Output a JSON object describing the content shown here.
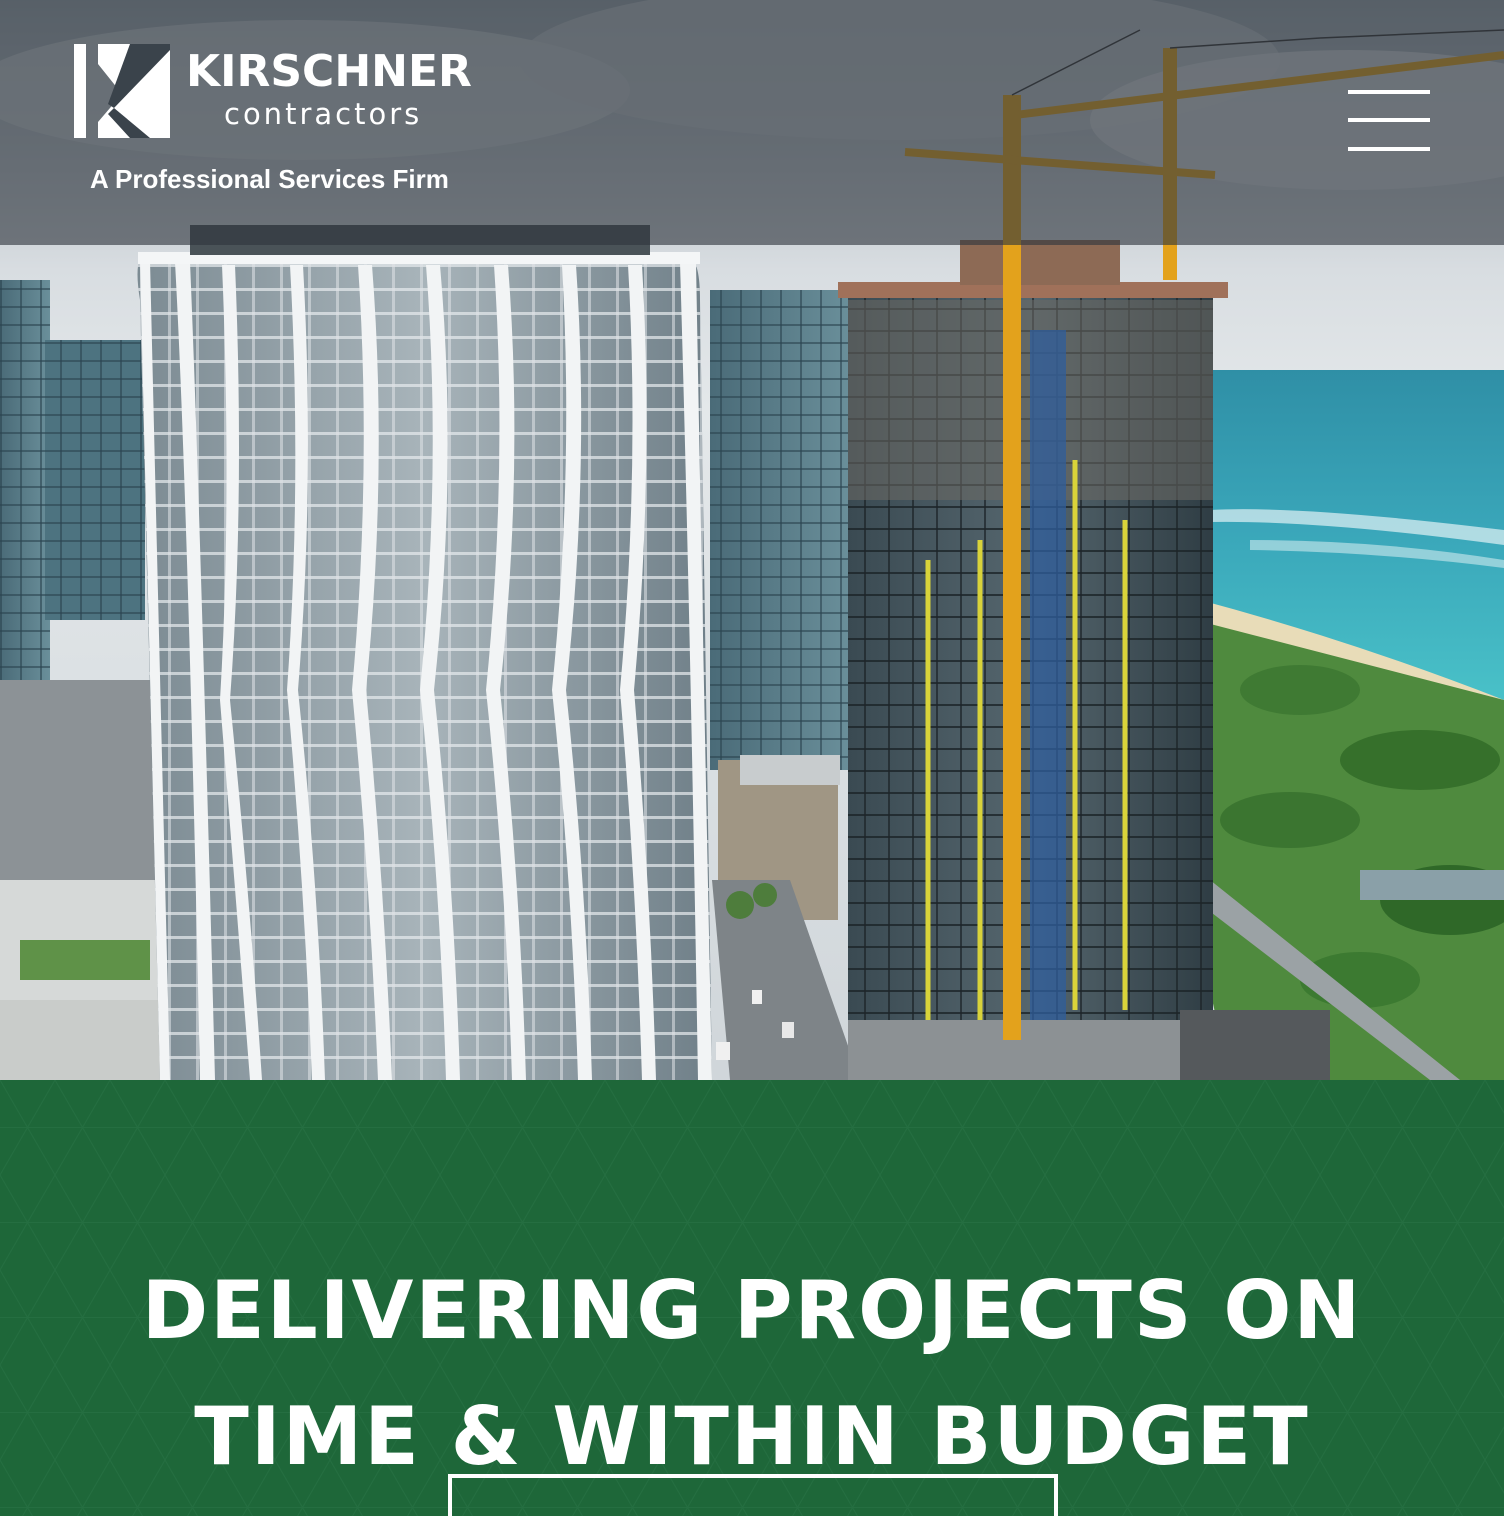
{
  "brand": {
    "name": "KIRSCHNER",
    "subname": "contractors",
    "tagline": "A Professional Services Firm"
  },
  "header": {
    "menu_icon": "hamburger-menu-icon"
  },
  "hero": {
    "image": "aerial-construction-towers-photo"
  },
  "cta_section": {
    "headline_line1": "DELIVERING PROJECTS ON",
    "headline_line2": "TIME & WITHIN BUDGET",
    "button_label": ""
  },
  "colors": {
    "brand_green": "#1e6739",
    "header_overlay": "#2e363e",
    "text": "#ffffff"
  }
}
